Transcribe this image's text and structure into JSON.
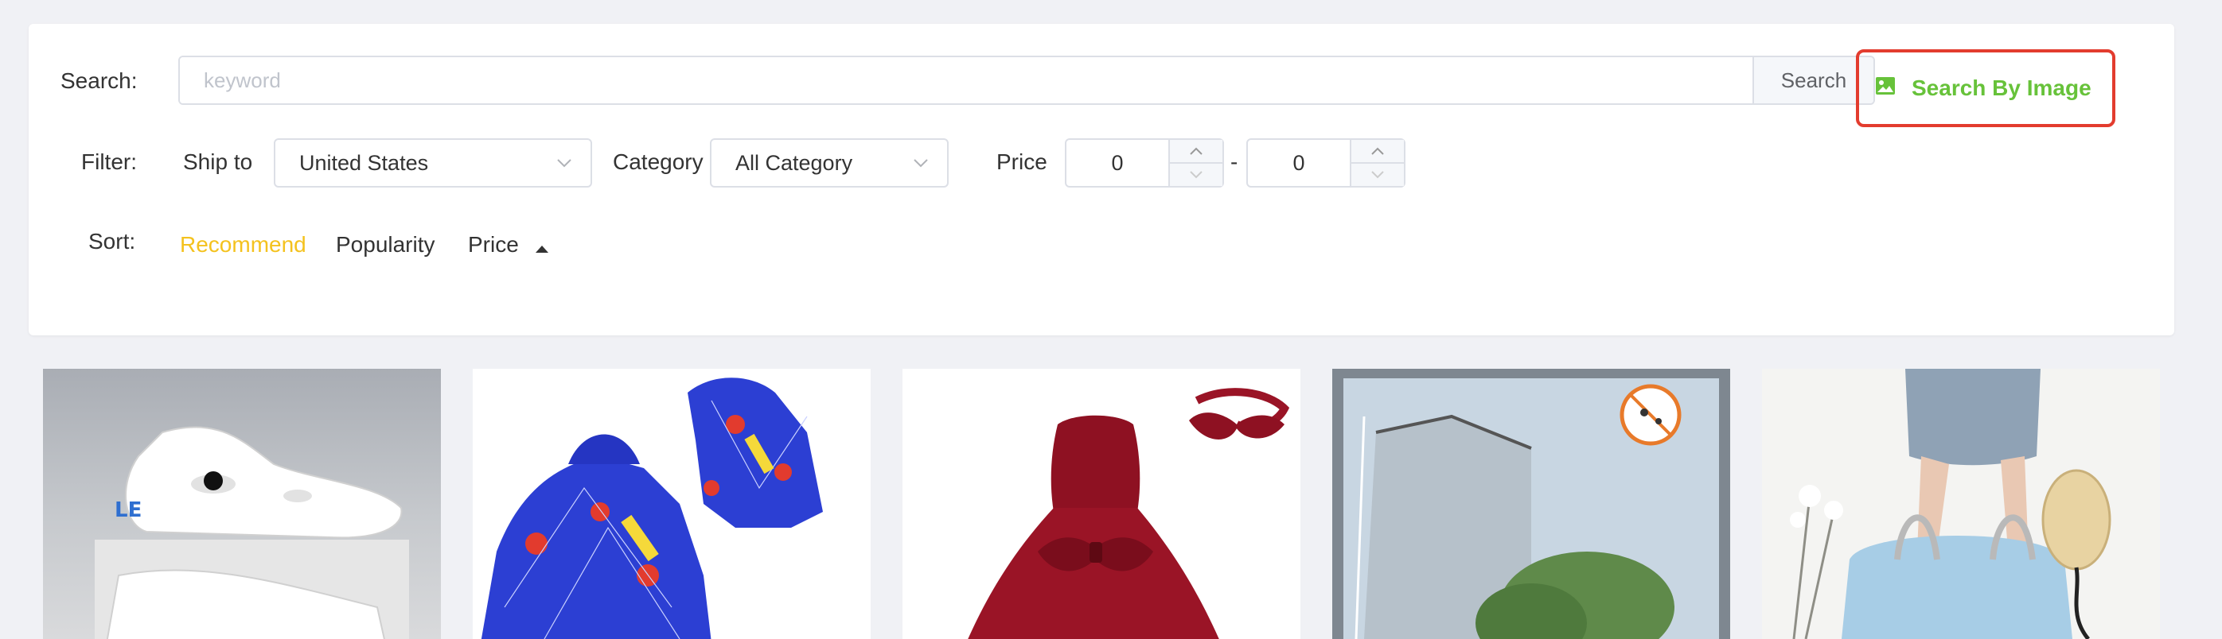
{
  "search": {
    "label": "Search:",
    "placeholder": "keyword",
    "value": "",
    "button_label": "Search",
    "image_search_label": "Search By Image"
  },
  "filter": {
    "label": "Filter:",
    "ship_to_label": "Ship to",
    "ship_to_value": "United States",
    "category_label": "Category",
    "category_value": "All Category",
    "price_label": "Price",
    "price_min": "0",
    "price_separator": "-",
    "price_max": "0"
  },
  "sort": {
    "label": "Sort:",
    "options": [
      "Recommend",
      "Popularity",
      "Price"
    ],
    "active": "Recommend"
  },
  "colors": {
    "accent_active": "#f4c21e",
    "image_search_green": "#67c23a",
    "highlight_red": "#e33c2e"
  },
  "products": [
    {
      "icon": "white-clog-shoes-image"
    },
    {
      "icon": "spiderman-hoodie-image"
    },
    {
      "icon": "red-girls-dress-image"
    },
    {
      "icon": "window-screen-net-image"
    },
    {
      "icon": "travel-duffel-bag-image"
    }
  ]
}
